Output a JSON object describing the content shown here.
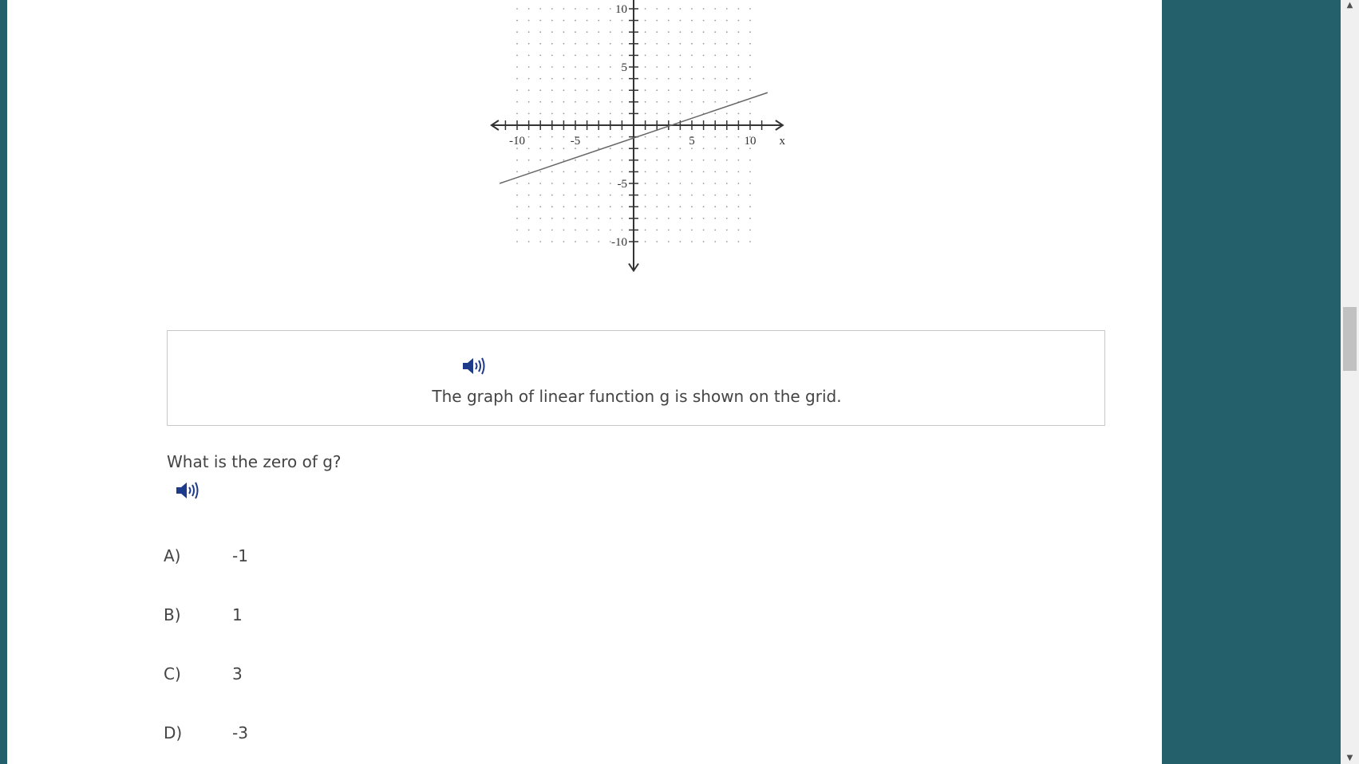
{
  "graph": {
    "type": "line",
    "x_axis_label": "x",
    "x_ticks": [
      "-10",
      "-5",
      "5",
      "10"
    ],
    "y_ticks": [
      "10",
      "5",
      "-5",
      "-10"
    ],
    "xlim": [
      -10,
      10
    ],
    "ylim": [
      -10,
      10
    ],
    "grid": "dotted",
    "line_points": [
      [
        -11.5,
        -5.0
      ],
      [
        11.5,
        2.8
      ]
    ]
  },
  "stimulus": {
    "text": "The graph of linear function g is shown on the grid."
  },
  "question": {
    "text": "What is the zero of g?"
  },
  "options": [
    {
      "letter": "A)",
      "value": "-1"
    },
    {
      "letter": "B)",
      "value": "1"
    },
    {
      "letter": "C)",
      "value": "3"
    },
    {
      "letter": "D)",
      "value": "-3"
    }
  ],
  "colors": {
    "background_teal": "#245f6c",
    "speaker_icon": "#1e3a8a",
    "text": "#444444"
  }
}
